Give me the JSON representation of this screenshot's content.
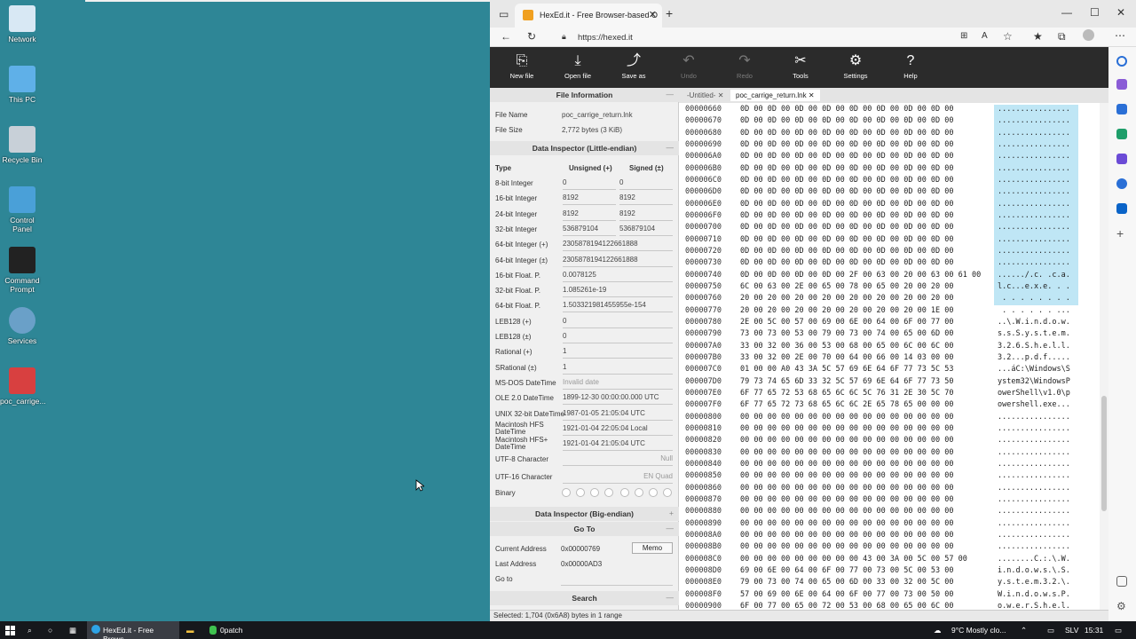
{
  "desktop": {
    "icons": [
      {
        "label": "Network",
        "icon": "network-icon"
      },
      {
        "label": "This PC",
        "icon": "computer-icon"
      },
      {
        "label": "Recycle Bin",
        "icon": "recycle-bin-icon"
      },
      {
        "label": "Control Panel",
        "icon": "control-panel-icon"
      },
      {
        "label": "Command Prompt",
        "icon": "command-prompt-icon"
      },
      {
        "label": "Services",
        "icon": "services-gear-icon"
      },
      {
        "label": "poc_carrige...",
        "icon": "pdf-file-icon"
      }
    ]
  },
  "browser": {
    "tab_title": "HexEd.it - Free Browser-based O",
    "url": "https://hexed.it"
  },
  "toolbar": {
    "buttons": [
      {
        "label": "New file",
        "icon": "new-file-icon",
        "enabled": true
      },
      {
        "label": "Open file",
        "icon": "open-file-icon",
        "enabled": true
      },
      {
        "label": "Save as",
        "icon": "save-as-icon",
        "enabled": true
      },
      {
        "label": "Undo",
        "icon": "undo-icon",
        "enabled": false
      },
      {
        "label": "Redo",
        "icon": "redo-icon",
        "enabled": false
      },
      {
        "label": "Tools",
        "icon": "tools-icon",
        "enabled": true
      },
      {
        "label": "Settings",
        "icon": "gear-icon",
        "enabled": true
      },
      {
        "label": "Help",
        "icon": "help-icon",
        "enabled": true
      }
    ]
  },
  "file_info": {
    "heading": "File Information",
    "name_label": "File Name",
    "name_value": "poc_carrige_return.lnk",
    "size_label": "File Size",
    "size_value": "2,772 bytes (3 KiB)"
  },
  "inspector": {
    "heading": "Data Inspector (Little-endian)",
    "col_type": "Type",
    "col_unsigned": "Unsigned (+)",
    "col_signed": "Signed (±)",
    "rows": [
      {
        "type": "8-bit Integer",
        "unsigned": "0",
        "signed": "0"
      },
      {
        "type": "16-bit Integer",
        "unsigned": "8192",
        "signed": "8192"
      },
      {
        "type": "24-bit Integer",
        "unsigned": "8192",
        "signed": "8192"
      },
      {
        "type": "32-bit Integer",
        "unsigned": "536879104",
        "signed": "536879104"
      }
    ],
    "single_rows": [
      {
        "type": "64-bit Integer (+)",
        "value": "2305878194122661888"
      },
      {
        "type": "64-bit Integer (±)",
        "value": "2305878194122661888"
      },
      {
        "type": "16-bit Float. P.",
        "value": "0.0078125"
      },
      {
        "type": "32-bit Float. P.",
        "value": "1.085261e-19"
      },
      {
        "type": "64-bit Float. P.",
        "value": "1.503321981455955e-154"
      },
      {
        "type": "LEB128 (+)",
        "value": "0"
      },
      {
        "type": "LEB128 (±)",
        "value": "0"
      },
      {
        "type": "Rational (+)",
        "value": "1"
      },
      {
        "type": "SRational (±)",
        "value": "1"
      },
      {
        "type": "MS-DOS DateTime",
        "value": "Invalid date"
      },
      {
        "type": "OLE 2.0 DateTime",
        "value": "1899-12-30 00:00:00.000 UTC"
      },
      {
        "type": "UNIX 32-bit DateTime",
        "value": "1987-01-05 21:05:04 UTC"
      },
      {
        "type": "Macintosh HFS DateTime",
        "value": "1921-01-04 22:05:04 Local"
      },
      {
        "type": "Macintosh HFS+ DateTime",
        "value": "1921-01-04 21:05:04 UTC"
      },
      {
        "type": "UTF-8 Character",
        "value": "Null"
      },
      {
        "type": "UTF-16 Character",
        "value": "EN Quad"
      }
    ],
    "binary_label": "Binary",
    "big_endian_heading": "Data Inspector (Big-endian)"
  },
  "goto": {
    "heading": "Go To",
    "current_label": "Current Address",
    "current_value": "0x00000769",
    "memo_button": "Memo",
    "last_label": "Last Address",
    "last_value": "0x00000AD3",
    "goto_label": "Go to"
  },
  "search": {
    "heading": "Search"
  },
  "file_tabs": [
    {
      "label": "-Untitled-",
      "active": false
    },
    {
      "label": "poc_carrige_return.lnk",
      "active": true
    }
  ],
  "hex_rows": [
    {
      "addr": "00000660",
      "hex": "0D 00 0D 00 0D 00 0D 00 0D 00 0D 00 0D 00 0D 00",
      "ascii": "................"
    },
    {
      "addr": "00000670",
      "hex": "0D 00 0D 00 0D 00 0D 00 0D 00 0D 00 0D 00 0D 00",
      "ascii": "................"
    },
    {
      "addr": "00000680",
      "hex": "0D 00 0D 00 0D 00 0D 00 0D 00 0D 00 0D 00 0D 00",
      "ascii": "................"
    },
    {
      "addr": "00000690",
      "hex": "0D 00 0D 00 0D 00 0D 00 0D 00 0D 00 0D 00 0D 00",
      "ascii": "................"
    },
    {
      "addr": "000006A0",
      "hex": "0D 00 0D 00 0D 00 0D 00 0D 00 0D 00 0D 00 0D 00",
      "ascii": "................"
    },
    {
      "addr": "000006B0",
      "hex": "0D 00 0D 00 0D 00 0D 00 0D 00 0D 00 0D 00 0D 00",
      "ascii": "................"
    },
    {
      "addr": "000006C0",
      "hex": "0D 00 0D 00 0D 00 0D 00 0D 00 0D 00 0D 00 0D 00",
      "ascii": "................"
    },
    {
      "addr": "000006D0",
      "hex": "0D 00 0D 00 0D 00 0D 00 0D 00 0D 00 0D 00 0D 00",
      "ascii": "................"
    },
    {
      "addr": "000006E0",
      "hex": "0D 00 0D 00 0D 00 0D 00 0D 00 0D 00 0D 00 0D 00",
      "ascii": "................"
    },
    {
      "addr": "000006F0",
      "hex": "0D 00 0D 00 0D 00 0D 00 0D 00 0D 00 0D 00 0D 00",
      "ascii": "................"
    },
    {
      "addr": "00000700",
      "hex": "0D 00 0D 00 0D 00 0D 00 0D 00 0D 00 0D 00 0D 00",
      "ascii": "................"
    },
    {
      "addr": "00000710",
      "hex": "0D 00 0D 00 0D 00 0D 00 0D 00 0D 00 0D 00 0D 00",
      "ascii": "................"
    },
    {
      "addr": "00000720",
      "hex": "0D 00 0D 00 0D 00 0D 00 0D 00 0D 00 0D 00 0D 00",
      "ascii": "................"
    },
    {
      "addr": "00000730",
      "hex": "0D 00 0D 00 0D 00 0D 00 0D 00 0D 00 0D 00 0D 00",
      "ascii": "................"
    },
    {
      "addr": "00000740",
      "hex": "0D 00 0D 00 0D 00 0D 00 2F 00 63 00 20 00 63 00 61 00",
      "ascii": "....../.c. .c.a."
    },
    {
      "addr": "00000750",
      "hex": "6C 00 63 00 2E 00 65 00 78 00 65 00 20 00 20 00",
      "ascii": "l.c...e.x.e. . ."
    },
    {
      "addr": "00000760",
      "hex": "20 00 20 00 20 00 20 00 20 00 20 00 20 00 20 00",
      "ascii": " . . . . . . . ."
    },
    {
      "addr": "00000770",
      "hex": "20 00 20 00 20 00 20 00 20 00 20 00 20 00 1E 00",
      "ascii": " . . . . . . ..."
    },
    {
      "addr": "00000780",
      "hex": "2E 00 5C 00 57 00 69 00 6E 00 64 00 6F 00 77 00",
      "ascii": "..\\.W.i.n.d.o.w."
    },
    {
      "addr": "00000790",
      "hex": "73 00 73 00 53 00 79 00 73 00 74 00 65 00 6D 00",
      "ascii": "s.s.S.y.s.t.e.m."
    },
    {
      "addr": "000007A0",
      "hex": "33 00 32 00 36 00 53 00 68 00 65 00 6C 00 6C 00",
      "ascii": "3.2.6.S.h.e.l.l."
    },
    {
      "addr": "000007B0",
      "hex": "33 00 32 00 2E 00 70 00 64 00 66 00 14 03 00 00",
      "ascii": "3.2...p.d.f....."
    },
    {
      "addr": "000007C0",
      "hex": "01 00 00 A0 43 3A 5C 57 69 6E 64 6F 77 73 5C 53",
      "ascii": "...áC:\\Windows\\S"
    },
    {
      "addr": "000007D0",
      "hex": "79 73 74 65 6D 33 32 5C 57 69 6E 64 6F 77 73 50",
      "ascii": "ystem32\\WindowsP"
    },
    {
      "addr": "000007E0",
      "hex": "6F 77 65 72 53 68 65 6C 6C 5C 76 31 2E 30 5C 70",
      "ascii": "owerShell\\v1.0\\p"
    },
    {
      "addr": "000007F0",
      "hex": "6F 77 65 72 73 68 65 6C 6C 2E 65 78 65 00 00 00",
      "ascii": "owershell.exe..."
    },
    {
      "addr": "00000800",
      "hex": "00 00 00 00 00 00 00 00 00 00 00 00 00 00 00 00",
      "ascii": "................"
    },
    {
      "addr": "00000810",
      "hex": "00 00 00 00 00 00 00 00 00 00 00 00 00 00 00 00",
      "ascii": "................"
    },
    {
      "addr": "00000820",
      "hex": "00 00 00 00 00 00 00 00 00 00 00 00 00 00 00 00",
      "ascii": "................"
    },
    {
      "addr": "00000830",
      "hex": "00 00 00 00 00 00 00 00 00 00 00 00 00 00 00 00",
      "ascii": "................"
    },
    {
      "addr": "00000840",
      "hex": "00 00 00 00 00 00 00 00 00 00 00 00 00 00 00 00",
      "ascii": "................"
    },
    {
      "addr": "00000850",
      "hex": "00 00 00 00 00 00 00 00 00 00 00 00 00 00 00 00",
      "ascii": "................"
    },
    {
      "addr": "00000860",
      "hex": "00 00 00 00 00 00 00 00 00 00 00 00 00 00 00 00",
      "ascii": "................"
    },
    {
      "addr": "00000870",
      "hex": "00 00 00 00 00 00 00 00 00 00 00 00 00 00 00 00",
      "ascii": "................"
    },
    {
      "addr": "00000880",
      "hex": "00 00 00 00 00 00 00 00 00 00 00 00 00 00 00 00",
      "ascii": "................"
    },
    {
      "addr": "00000890",
      "hex": "00 00 00 00 00 00 00 00 00 00 00 00 00 00 00 00",
      "ascii": "................"
    },
    {
      "addr": "000008A0",
      "hex": "00 00 00 00 00 00 00 00 00 00 00 00 00 00 00 00",
      "ascii": "................"
    },
    {
      "addr": "000008B0",
      "hex": "00 00 00 00 00 00 00 00 00 00 00 00 00 00 00 00",
      "ascii": "................"
    },
    {
      "addr": "000008C0",
      "hex": "00 00 00 00 00 00 00 00 00 43 00 3A 00 5C 00 57 00",
      "ascii": "........C.:.\\.W."
    },
    {
      "addr": "000008D0",
      "hex": "69 00 6E 00 64 00 6F 00 77 00 73 00 5C 00 53 00",
      "ascii": "i.n.d.o.w.s.\\.S."
    },
    {
      "addr": "000008E0",
      "hex": "79 00 73 00 74 00 65 00 6D 00 33 00 32 00 5C 00",
      "ascii": "y.s.t.e.m.3.2.\\."
    },
    {
      "addr": "000008F0",
      "hex": "57 00 69 00 6E 00 64 00 6F 00 77 00 73 00 50 00",
      "ascii": "W.i.n.d.o.w.s.P."
    },
    {
      "addr": "00000900",
      "hex": "6F 00 77 00 65 00 72 00 53 00 68 00 65 00 6C 00",
      "ascii": "o.w.e.r.S.h.e.l."
    }
  ],
  "status": "Selected: 1,704 (0x6A8) bytes in 1 range",
  "taskbar": {
    "app1": "HexEd.it - Free Brows...",
    "app2": "0patch",
    "weather": "9°C  Mostly clo...",
    "lang": "SLV",
    "time": "15:31"
  }
}
